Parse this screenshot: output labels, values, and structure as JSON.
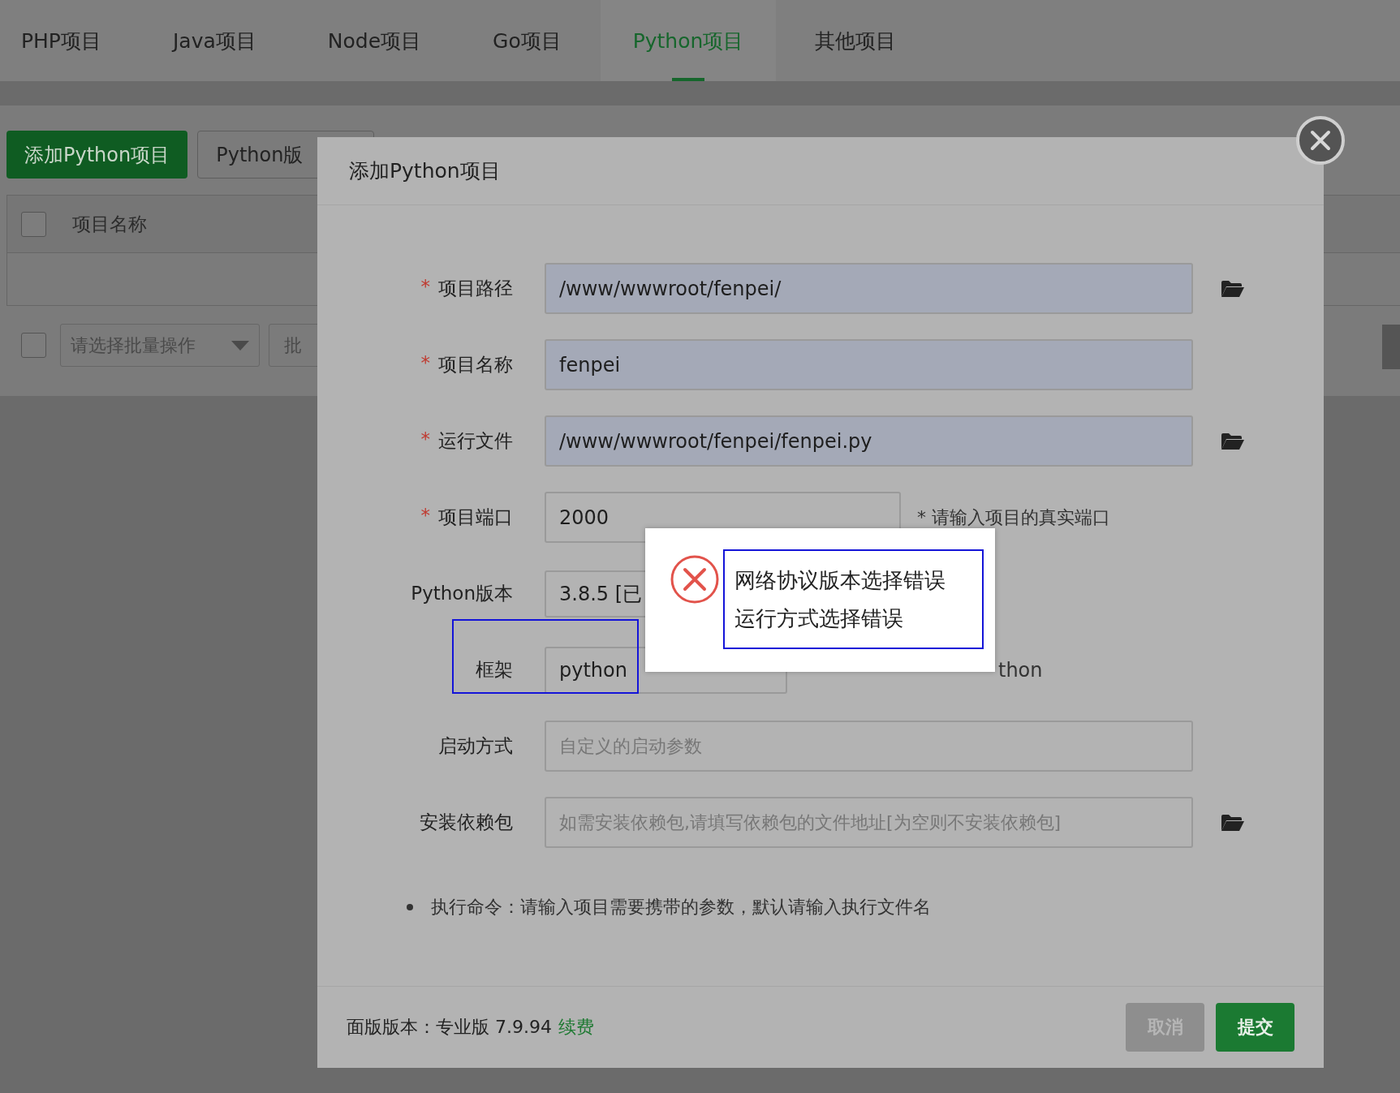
{
  "tabs": [
    {
      "label": "PHP项目",
      "selected": false
    },
    {
      "label": "Java项目",
      "selected": false
    },
    {
      "label": "Node项目",
      "selected": false
    },
    {
      "label": "Go项目",
      "selected": false
    },
    {
      "label": "Python项目",
      "selected": true
    },
    {
      "label": "其他项目",
      "selected": false
    }
  ],
  "toolbar": {
    "add_button": "添加Python项目",
    "version_button": "Python版"
  },
  "table": {
    "header_checkbox": {
      "checked": false
    },
    "columns": [
      "项目名称"
    ]
  },
  "batch": {
    "checkbox": {
      "checked": false
    },
    "placeholder": "请选择批量操作",
    "button": "批"
  },
  "modal": {
    "title": "添加Python项目",
    "fields": [
      {
        "kind": "input",
        "label": "项目路径",
        "required_mark": "*",
        "value": "/www/wwwroot/fenpei/",
        "autofilled": true,
        "folder": true
      },
      {
        "kind": "input",
        "label": "项目名称",
        "required_mark": "*",
        "value": "fenpei",
        "autofilled": true,
        "folder": false
      },
      {
        "kind": "input",
        "label": "运行文件",
        "required_mark": "*",
        "value": "/www/wwwroot/fenpei/fenpei.py",
        "autofilled": true,
        "folder": true
      },
      {
        "kind": "short",
        "label": "项目端口",
        "required_mark": "*",
        "value": "2000",
        "autofilled": false,
        "folder": false,
        "hint": "* 请输入项目的真实端口"
      },
      {
        "kind": "select",
        "label": "Python版本",
        "value": "3.8.5 [已",
        "autofilled": false,
        "folder": false
      },
      {
        "kind": "select",
        "label": "框架",
        "value": "python",
        "autofilled": false,
        "folder": false,
        "hint": "thon"
      },
      {
        "kind": "input",
        "label": "启动方式",
        "placeholder": "自定义的启动参数",
        "autofilled": false,
        "folder": false
      },
      {
        "kind": "input",
        "label": "安装依赖包",
        "placeholder": "如需安装依赖包,请填写依赖包的文件地址[为空则不安装依赖包]",
        "autofilled": false,
        "folder": true
      }
    ],
    "note": "执行命令：请输入项目需要携带的参数，默认请输入执行文件名",
    "footer": {
      "version": "面版版本：专业版 7.9.94",
      "renew_link": "续费",
      "buttons": [
        {
          "label": "取消",
          "kind": "cancel"
        },
        {
          "label": "提交",
          "kind": "submit"
        }
      ]
    }
  },
  "toast": {
    "messages": [
      "网络协议版本选择错误",
      "运行方式选择错误"
    ]
  }
}
